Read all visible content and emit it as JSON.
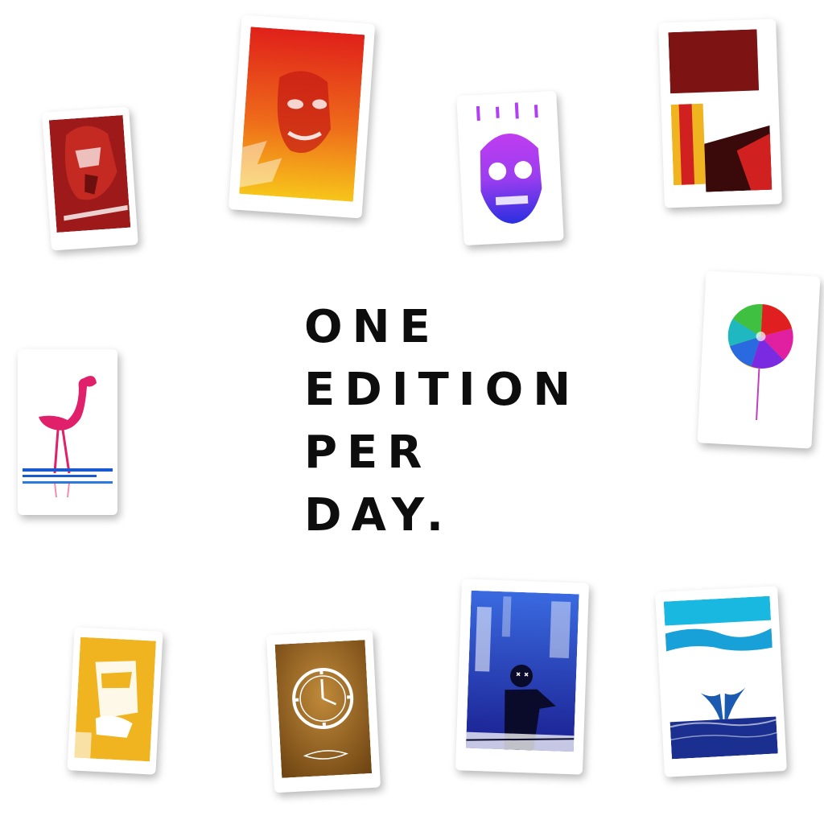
{
  "headline": {
    "line1": "ONE",
    "line2": "EDITION",
    "line3": "PER",
    "line4": "DAY."
  },
  "colors": {
    "text": "#0d0d0d",
    "card_red": "#9e1a1a",
    "card_fire_top": "#e0201a",
    "card_fire_bottom": "#f7c51a",
    "card_violet": "#9b3df0",
    "card_blue": "#2a2fe0",
    "card_pink": "#e0206a",
    "card_gold": "#f0b420",
    "card_bronze": "#8a5a1a",
    "card_navy": "#1a2fb0",
    "card_sky": "#18b8e0"
  },
  "cards": [
    "red-portrait-card",
    "fire-face-card",
    "neon-skull-card",
    "abstract-red-card",
    "flamingo-card",
    "rainbow-lollipop-card",
    "gold-portrait-card",
    "clock-card",
    "blue-figure-card",
    "whale-tail-card"
  ]
}
